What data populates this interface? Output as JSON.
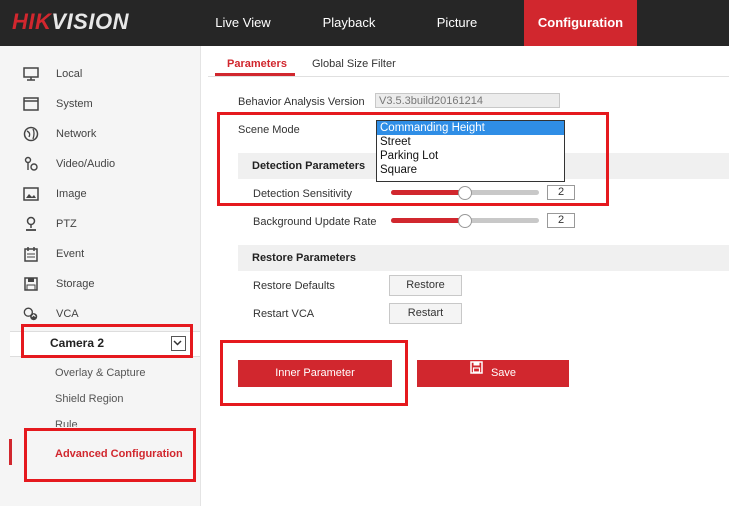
{
  "header": {
    "logo_brand": "HIK",
    "logo_rest": "VISION",
    "nav": [
      "Live View",
      "Playback",
      "Picture",
      "Configuration"
    ],
    "active_nav": "Configuration"
  },
  "sidebar": {
    "items": [
      {
        "label": "Local",
        "icon": "monitor-icon"
      },
      {
        "label": "System",
        "icon": "system-icon"
      },
      {
        "label": "Network",
        "icon": "globe-icon"
      },
      {
        "label": "Video/Audio",
        "icon": "video-audio-icon"
      },
      {
        "label": "Image",
        "icon": "image-icon"
      },
      {
        "label": "PTZ",
        "icon": "ptz-icon"
      },
      {
        "label": "Event",
        "icon": "calendar-icon"
      },
      {
        "label": "Storage",
        "icon": "storage-icon"
      },
      {
        "label": "VCA",
        "icon": "vca-icon"
      }
    ],
    "camera_select": "Camera 2",
    "sub_items": [
      "Overlay & Capture",
      "Shield Region",
      "Rule"
    ],
    "active_sub": "Advanced Configuration"
  },
  "tabs": [
    "Parameters",
    "Global Size Filter"
  ],
  "form": {
    "version_label": "Behavior Analysis Version",
    "version_value": "V3.5.3build20161214",
    "scene_mode_label": "Scene Mode",
    "scene_mode_options": [
      "Commanding Height",
      "Street",
      "Parking Lot",
      "Square"
    ],
    "scene_mode_selected": "Commanding Height",
    "detection_section": "Detection Parameters",
    "sensitivity_label": "Detection Sensitivity",
    "sensitivity_value": "2",
    "sensitivity_fraction": 0.5,
    "bg_update_label": "Background Update Rate",
    "bg_update_value": "2",
    "bg_update_fraction": 0.5,
    "restore_section": "Restore Parameters",
    "restore_defaults_label": "Restore Defaults",
    "restore_button": "Restore",
    "restart_vca_label": "Restart VCA",
    "restart_button": "Restart"
  },
  "actions": {
    "inner_parameter": "Inner Parameter",
    "save": "Save"
  },
  "colors": {
    "accent": "#d1272e",
    "topbar": "#262626",
    "selection": "#2f8ee6",
    "annotation": "#e5191e"
  }
}
